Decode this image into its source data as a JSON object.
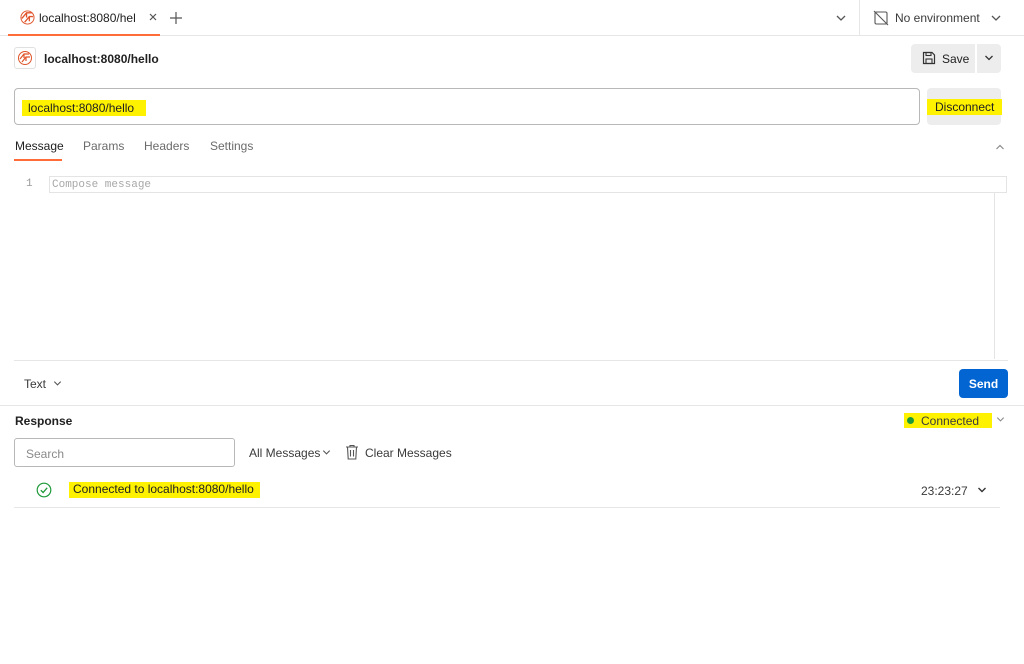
{
  "tab": {
    "label": "localhost:8080/hel"
  },
  "environment": {
    "label": "No environment"
  },
  "header": {
    "title": "localhost:8080/hello",
    "save_label": "Save"
  },
  "url_bar": {
    "value": "localhost:8080/hello",
    "disconnect_label": "Disconnect"
  },
  "sub_tabs": [
    "Message",
    "Params",
    "Headers",
    "Settings"
  ],
  "editor": {
    "line_number": "1",
    "placeholder": "Compose message",
    "message_type": "Text",
    "send_label": "Send"
  },
  "response": {
    "title": "Response",
    "status": "Connected",
    "search_placeholder": "Search",
    "filter_label": "All Messages",
    "clear_label": "Clear Messages",
    "messages": [
      {
        "text": "Connected to localhost:8080/hello",
        "time": "23:23:27",
        "icon": "check-circle-icon"
      }
    ]
  },
  "colors": {
    "accent": "#ff6c37",
    "send": "#0265d2",
    "highlight": "#fff200",
    "connected": "#1f9a3a"
  }
}
